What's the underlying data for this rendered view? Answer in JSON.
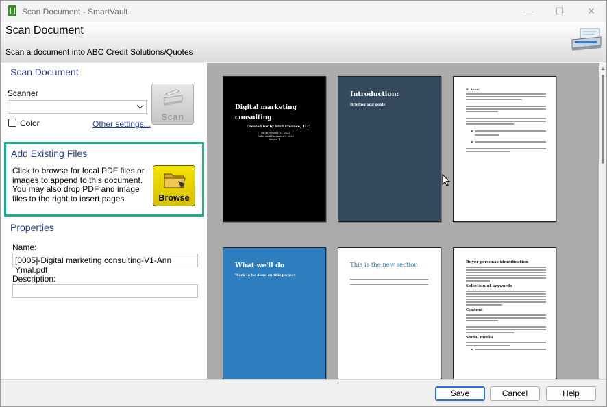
{
  "window": {
    "title": "Scan Document - SmartVault",
    "minimize_glyph": "—",
    "maximize_glyph": "☐",
    "close_glyph": "✕"
  },
  "header": {
    "title": "Scan Document",
    "subtitle": "Scan a document into ABC Credit Solutions/Quotes"
  },
  "scan_section": {
    "title": "Scan Document",
    "scanner_label": "Scanner",
    "scanner_value": "",
    "color_label": "Color",
    "color_checked": false,
    "other_settings_link": "Other settings...",
    "scan_button": "Scan"
  },
  "add_files": {
    "title": "Add Existing Files",
    "description": "Click to browse for local PDF files or images to append to this document.  You may also drop PDF and image files to the right to insert pages.",
    "browse_button": "Browse",
    "highlight_color": "#1db090"
  },
  "properties": {
    "title": "Properties",
    "name_label": "Name:",
    "name_value": "[0005]-Digital marketing consulting-V1-Ann Ymal.pdf",
    "description_label": "Description:",
    "description_value": ""
  },
  "pages": [
    {
      "title": "Digital marketing consulting",
      "subtitle": "Created for  by Bird Finance, LLC",
      "lines": [
        "On ae October 01, 2022",
        "Valid until December 9, 2022",
        "Version 1"
      ],
      "bg": "#000000"
    },
    {
      "title": "Introduction:",
      "subtitle": "Briefing and goals",
      "bg": "#34495e"
    },
    {
      "title": "Hi Anne!",
      "bg": "#ffffff"
    },
    {
      "title": "What we'll do",
      "subtitle": "Work to be done on this project",
      "bg": "#2e7dbf"
    },
    {
      "title": "This is the new section",
      "bg": "#ffffff"
    },
    {
      "headings": [
        "Buyer personas identification",
        "Selection of keywords",
        "Content",
        "Social media"
      ],
      "bg": "#ffffff"
    }
  ],
  "buttons": {
    "save": "Save",
    "cancel": "Cancel",
    "help": "Help"
  },
  "icons": [
    "app-icon",
    "scanner-icon",
    "folder-icon",
    "chevron-down-icon",
    "cursor-icon"
  ]
}
